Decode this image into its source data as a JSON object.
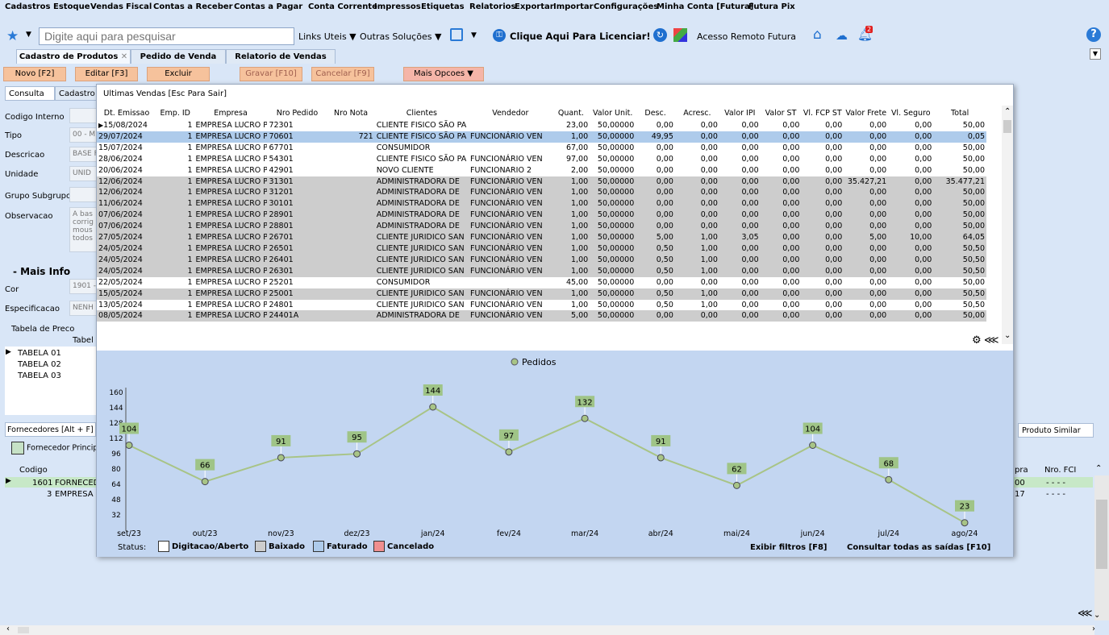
{
  "menu": [
    "Cadastros",
    "Estoque",
    "Vendas",
    "Fiscal",
    "Contas a Receber",
    "Contas a Pagar",
    "Conta Corrente",
    "Impressos",
    "Etiquetas",
    "Relatorios",
    "Exportar",
    "Importar",
    "Configurações",
    "Minha Conta [Futura]",
    "Futura Pix"
  ],
  "toolbar": {
    "search_placeholder": "Digite aqui para pesquisar",
    "links_uteis": "Links Uteis",
    "outras_solucoes": "Outras Soluções",
    "licenciar": "Clique Aqui Para Licenciar!",
    "acesso_remoto": "Acesso Remoto Futura",
    "notification_count": "2"
  },
  "tabs": [
    "Cadastro de Produtos",
    "Pedido de Venda",
    "Relatorio de Vendas"
  ],
  "actions": {
    "novo": "Novo [F2]",
    "editar": "Editar [F3]",
    "excluir": "Excluir",
    "gravar": "Gravar [F10]",
    "cancelar": "Cancelar [F9]",
    "mais": "Mais Opcoes"
  },
  "left": {
    "tab_consulta": "Consulta",
    "tab_cadastro": "Cadastro",
    "codigo_interno": "Codigo Interno",
    "tipo": "Tipo",
    "tipo_val": "00 - M",
    "descricao": "Descricao",
    "descricao_val": "BASE F",
    "unidade": "Unidade",
    "unidade_val": "UNID",
    "grupo": "Grupo Subgrupo",
    "observacao": "Observacao",
    "observacao_val": "A bas corrig mous todos",
    "mais_info": "- Mais Info",
    "cor": "Cor",
    "cor_val": "1901 -",
    "especificacao": "Especificacao",
    "especificacao_val": "NENH",
    "tabela_preco": "Tabela de Preco",
    "tabela_col": "Tabel",
    "tabelas": [
      "TABELA 01",
      "TABELA 02",
      "TABELA 03"
    ],
    "fornecedores": "Fornecedores [Alt + F]",
    "fornecedor_principal": "Fornecedor Princip",
    "codigo_col": "Codigo",
    "forn_rows": [
      {
        "cod": "1601",
        "name": "FORNECED"
      },
      {
        "cod": "3",
        "name": "EMPRESA L"
      }
    ],
    "produto_similar": "Produto Similar",
    "compra_col": "pra",
    "nro_fci": "Nro. FCI",
    "compra_vals": [
      "00",
      "17"
    ],
    "fci_vals": [
      "- - - -",
      "- - - -"
    ]
  },
  "modal": {
    "title": "Ultimas Vendas [Esc Para Sair]",
    "columns": [
      "Dt. Emissao",
      "Emp. ID",
      "Empresa",
      "Nro Pedido",
      "Nro Nota",
      "Clientes",
      "Vendedor",
      "Quant.",
      "Valor Unit.",
      "Desc.",
      "Acresc.",
      "Valor IPI",
      "Valor ST",
      "Vl. FCP ST",
      "Valor Frete",
      "Vl. Seguro",
      "Total"
    ],
    "rows": [
      {
        "s": "white",
        "c": [
          "15/08/2024",
          "1",
          "EMPRESA LUCRO PRESI",
          "72301",
          "",
          "CLIENTE FISICO SÃO PA",
          "",
          "23,00",
          "50,00000",
          "0,00",
          "0,00",
          "0,00",
          "0,00",
          "0,00",
          "0,00",
          "0,00",
          "50,00"
        ]
      },
      {
        "s": "sel",
        "c": [
          "29/07/2024",
          "1",
          "EMPRESA LUCRO PRESI",
          "70601",
          "721",
          "CLIENTE FISICO SÃO PA",
          "FUNCIONÁRIO VEN",
          "1,00",
          "50,00000",
          "49,95",
          "0,00",
          "0,00",
          "0,00",
          "0,00",
          "0,00",
          "0,00",
          "0,05"
        ]
      },
      {
        "s": "white",
        "c": [
          "15/07/2024",
          "1",
          "EMPRESA LUCRO PRESI",
          "67701",
          "",
          "CONSUMIDOR",
          "",
          "67,00",
          "50,00000",
          "0,00",
          "0,00",
          "0,00",
          "0,00",
          "0,00",
          "0,00",
          "0,00",
          "50,00"
        ]
      },
      {
        "s": "white",
        "c": [
          "28/06/2024",
          "1",
          "EMPRESA LUCRO PRESI",
          "54301",
          "",
          "CLIENTE FISICO SÃO PA",
          "FUNCIONÁRIO VEN",
          "97,00",
          "50,00000",
          "0,00",
          "0,00",
          "0,00",
          "0,00",
          "0,00",
          "0,00",
          "0,00",
          "50,00"
        ]
      },
      {
        "s": "white",
        "c": [
          "20/06/2024",
          "1",
          "EMPRESA LUCRO PRESI",
          "42901",
          "",
          "NOVO CLIENTE",
          "FUNCIONARIO 2",
          "2,00",
          "50,00000",
          "0,00",
          "0,00",
          "0,00",
          "0,00",
          "0,00",
          "0,00",
          "0,00",
          "50,00"
        ]
      },
      {
        "s": "gray",
        "c": [
          "12/06/2024",
          "1",
          "EMPRESA LUCRO PRESI",
          "31301",
          "",
          "ADMINISTRADORA DE",
          "FUNCIONÁRIO VEN",
          "1,00",
          "50,00000",
          "0,00",
          "0,00",
          "0,00",
          "0,00",
          "0,00",
          "35.427,21",
          "0,00",
          "35.477,21"
        ]
      },
      {
        "s": "gray",
        "c": [
          "12/06/2024",
          "1",
          "EMPRESA LUCRO PRESI",
          "31201",
          "",
          "ADMINISTRADORA DE",
          "FUNCIONÁRIO VEN",
          "1,00",
          "50,00000",
          "0,00",
          "0,00",
          "0,00",
          "0,00",
          "0,00",
          "0,00",
          "0,00",
          "50,00"
        ]
      },
      {
        "s": "gray",
        "c": [
          "11/06/2024",
          "1",
          "EMPRESA LUCRO PRESI",
          "30101",
          "",
          "ADMINISTRADORA DE",
          "FUNCIONÁRIO VEN",
          "1,00",
          "50,00000",
          "0,00",
          "0,00",
          "0,00",
          "0,00",
          "0,00",
          "0,00",
          "0,00",
          "50,00"
        ]
      },
      {
        "s": "gray",
        "c": [
          "07/06/2024",
          "1",
          "EMPRESA LUCRO PRESI",
          "28901",
          "",
          "ADMINISTRADORA DE",
          "FUNCIONÁRIO VEN",
          "1,00",
          "50,00000",
          "0,00",
          "0,00",
          "0,00",
          "0,00",
          "0,00",
          "0,00",
          "0,00",
          "50,00"
        ]
      },
      {
        "s": "gray",
        "c": [
          "07/06/2024",
          "1",
          "EMPRESA LUCRO PRESI",
          "28801",
          "",
          "ADMINISTRADORA DE",
          "FUNCIONÁRIO VEN",
          "1,00",
          "50,00000",
          "0,00",
          "0,00",
          "0,00",
          "0,00",
          "0,00",
          "0,00",
          "0,00",
          "50,00"
        ]
      },
      {
        "s": "gray",
        "c": [
          "27/05/2024",
          "1",
          "EMPRESA LUCRO PRESI",
          "26701",
          "",
          "CLIENTE JURIDICO SAN",
          "FUNCIONÁRIO VEN",
          "1,00",
          "50,00000",
          "5,00",
          "1,00",
          "3,05",
          "0,00",
          "0,00",
          "5,00",
          "10,00",
          "64,05"
        ]
      },
      {
        "s": "gray",
        "c": [
          "24/05/2024",
          "1",
          "EMPRESA LUCRO PRESI",
          "26501",
          "",
          "CLIENTE JURIDICO SAN",
          "FUNCIONÁRIO VEN",
          "1,00",
          "50,00000",
          "0,50",
          "1,00",
          "0,00",
          "0,00",
          "0,00",
          "0,00",
          "0,00",
          "50,50"
        ]
      },
      {
        "s": "gray",
        "c": [
          "24/05/2024",
          "1",
          "EMPRESA LUCRO PRESI",
          "26401",
          "",
          "CLIENTE JURIDICO SAN",
          "FUNCIONÁRIO VEN",
          "1,00",
          "50,00000",
          "0,50",
          "1,00",
          "0,00",
          "0,00",
          "0,00",
          "0,00",
          "0,00",
          "50,50"
        ]
      },
      {
        "s": "gray",
        "c": [
          "24/05/2024",
          "1",
          "EMPRESA LUCRO PRESI",
          "26301",
          "",
          "CLIENTE JURIDICO SAN",
          "FUNCIONÁRIO VEN",
          "1,00",
          "50,00000",
          "0,50",
          "1,00",
          "0,00",
          "0,00",
          "0,00",
          "0,00",
          "0,00",
          "50,50"
        ]
      },
      {
        "s": "white",
        "c": [
          "22/05/2024",
          "1",
          "EMPRESA LUCRO PRESI",
          "25201",
          "",
          "CONSUMIDOR",
          "",
          "45,00",
          "50,00000",
          "0,00",
          "0,00",
          "0,00",
          "0,00",
          "0,00",
          "0,00",
          "0,00",
          "50,00"
        ]
      },
      {
        "s": "gray",
        "c": [
          "15/05/2024",
          "1",
          "EMPRESA LUCRO PRESI",
          "25001",
          "",
          "CLIENTE JURIDICO SAN",
          "FUNCIONÁRIO VEN",
          "1,00",
          "50,00000",
          "0,50",
          "1,00",
          "0,00",
          "0,00",
          "0,00",
          "0,00",
          "0,00",
          "50,50"
        ]
      },
      {
        "s": "white",
        "c": [
          "13/05/2024",
          "1",
          "EMPRESA LUCRO PRESI",
          "24801",
          "",
          "CLIENTE JURIDICO SAN",
          "FUNCIONÁRIO VEN",
          "1,00",
          "50,00000",
          "0,50",
          "1,00",
          "0,00",
          "0,00",
          "0,00",
          "0,00",
          "0,00",
          "50,50"
        ]
      },
      {
        "s": "gray",
        "c": [
          "08/05/2024",
          "1",
          "EMPRESA LUCRO PRESI",
          "24401A",
          "",
          "ADMINISTRADORA DE",
          "FUNCIONÁRIO VEN",
          "5,00",
          "50,00000",
          "0,00",
          "0,00",
          "0,00",
          "0,00",
          "0,00",
          "0,00",
          "0,00",
          "50,00"
        ]
      }
    ],
    "status_label": "Status:",
    "status_items": [
      {
        "label": "Digitacao/Aberto",
        "color": "#ffffff"
      },
      {
        "label": "Baixado",
        "color": "#cdcdcd"
      },
      {
        "label": "Faturado",
        "color": "#aecbeb"
      },
      {
        "label": "Cancelado",
        "color": "#f08f8f"
      }
    ],
    "exibir_filtros": "Exibir filtros [F8]",
    "consultar": "Consultar todas as saídas [F10]"
  },
  "chart_data": {
    "type": "line",
    "legend": "Pedidos",
    "categories": [
      "set/23",
      "out/23",
      "nov/23",
      "dez/23",
      "jan/24",
      "fev/24",
      "mar/24",
      "abr/24",
      "mai/24",
      "jun/24",
      "jul/24",
      "ago/24"
    ],
    "values": [
      104,
      66,
      91,
      95,
      144,
      97,
      132,
      91,
      62,
      104,
      68,
      23
    ],
    "yticks": [
      32,
      48,
      64,
      80,
      96,
      112,
      128,
      144,
      160
    ],
    "ylim": [
      16,
      160
    ],
    "line_color": "#a8c486",
    "label_bg": "#9fc487"
  }
}
